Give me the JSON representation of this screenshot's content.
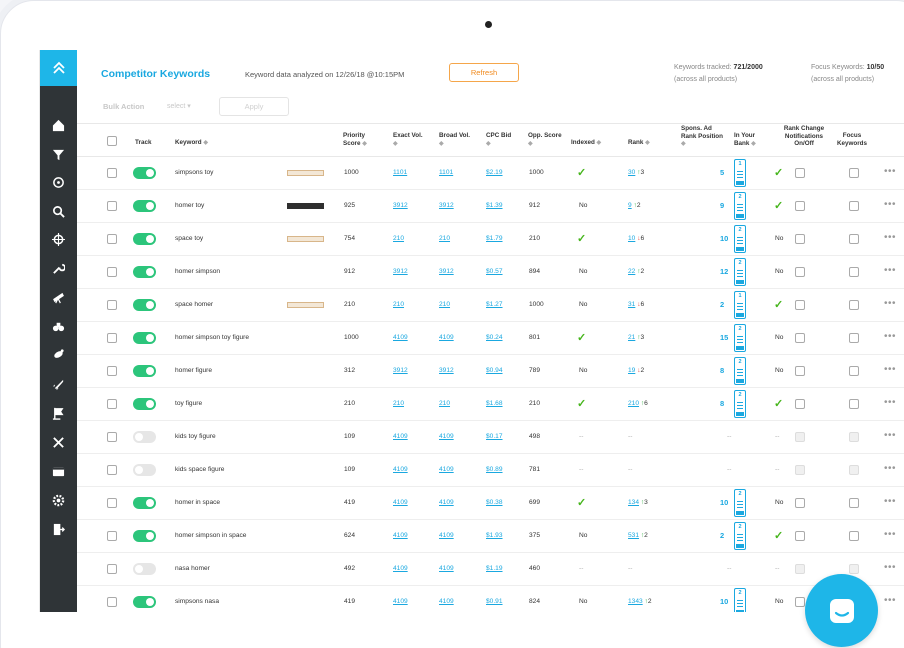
{
  "header": {
    "title": "Competitor Keywords",
    "analyzed": "Keyword data analyzed on 12/26/18 @10:15PM",
    "refresh_label": "Refresh",
    "tracked_label": "Keywords tracked:",
    "tracked_value": "721/2000",
    "tracked_note": "(across all products)",
    "focus_label": "Focus Keywords:",
    "focus_value": "10/50",
    "focus_note": "(across all products)"
  },
  "bulk": {
    "label": "Bulk Action",
    "select": "select",
    "apply": "Apply"
  },
  "columns": {
    "track": "Track",
    "keyword": "Keyword",
    "priority": "Priority Score",
    "exact": "Exact Vol.",
    "broad": "Broad Vol.",
    "cpc": "CPC Bid",
    "opp": "Opp. Score",
    "indexed": "Indexed",
    "rank": "Rank",
    "spons": "Spons. Ad Rank Position",
    "in_your_bank": "In Your Bank",
    "rank_change": "Rank Change Notifications On/Off",
    "focus": "Focus Keywords"
  },
  "rows": [
    {
      "on": true,
      "keyword": "simpsons toy",
      "badge": "light",
      "priority": "1000",
      "exact": "1101",
      "broad": "1101",
      "cpc": "$2.19",
      "opp": "1000",
      "indexed": "check",
      "rank": "30",
      "dir": "up",
      "change": "3",
      "spons": "5",
      "spons_rank": "1",
      "bank": "check"
    },
    {
      "on": true,
      "keyword": "homer toy",
      "badge": "dark",
      "priority": "925",
      "exact": "3912",
      "broad": "3912",
      "cpc": "$1.39",
      "opp": "912",
      "indexed": "No",
      "rank": "9",
      "dir": "up",
      "change": "2",
      "spons": "9",
      "spons_rank": "2",
      "bank": "check"
    },
    {
      "on": true,
      "keyword": "space toy",
      "badge": "light",
      "priority": "754",
      "exact": "210",
      "broad": "210",
      "cpc": "$1.79",
      "opp": "210",
      "indexed": "check",
      "rank": "10",
      "dir": "down",
      "change": "6",
      "spons": "10",
      "spons_rank": "2",
      "bank": "No"
    },
    {
      "on": true,
      "keyword": "homer simpson",
      "badge": "",
      "priority": "912",
      "exact": "3912",
      "broad": "3912",
      "cpc": "$0.57",
      "opp": "894",
      "indexed": "No",
      "rank": "22",
      "dir": "up",
      "change": "2",
      "spons": "12",
      "spons_rank": "2",
      "bank": "No"
    },
    {
      "on": true,
      "keyword": "space homer",
      "badge": "light",
      "priority": "210",
      "exact": "210",
      "broad": "210",
      "cpc": "$1.27",
      "opp": "1000",
      "indexed": "No",
      "rank": "31",
      "dir": "down",
      "change": "6",
      "spons": "2",
      "spons_rank": "1",
      "bank": "check"
    },
    {
      "on": true,
      "keyword": "homer simpson toy figure",
      "badge": "",
      "priority": "1000",
      "exact": "4109",
      "broad": "4109",
      "cpc": "$0.24",
      "opp": "801",
      "indexed": "check",
      "rank": "21",
      "dir": "up",
      "change": "3",
      "spons": "15",
      "spons_rank": "2",
      "bank": "No"
    },
    {
      "on": true,
      "keyword": "homer figure",
      "badge": "",
      "priority": "312",
      "exact": "3912",
      "broad": "3912",
      "cpc": "$0.94",
      "opp": "789",
      "indexed": "No",
      "rank": "19",
      "dir": "down",
      "change": "2",
      "spons": "8",
      "spons_rank": "2",
      "bank": "No"
    },
    {
      "on": true,
      "keyword": "toy figure",
      "badge": "",
      "priority": "210",
      "exact": "210",
      "broad": "210",
      "cpc": "$1.68",
      "opp": "210",
      "indexed": "check",
      "rank": "210",
      "dir": "up",
      "change": "6",
      "spons": "8",
      "spons_rank": "2",
      "bank": "check"
    },
    {
      "on": false,
      "keyword": "kids toy figure",
      "badge": "",
      "priority": "109",
      "exact": "4109",
      "broad": "4109",
      "cpc": "$0.17",
      "opp": "498",
      "indexed": "--",
      "rank": "--",
      "dir": "",
      "change": "",
      "spons": "--",
      "spons_rank": "",
      "bank": "--"
    },
    {
      "on": false,
      "keyword": "kids space figure",
      "badge": "",
      "priority": "109",
      "exact": "4109",
      "broad": "4109",
      "cpc": "$0.89",
      "opp": "781",
      "indexed": "--",
      "rank": "--",
      "dir": "",
      "change": "",
      "spons": "--",
      "spons_rank": "",
      "bank": "--"
    },
    {
      "on": true,
      "keyword": "homer in space",
      "badge": "",
      "priority": "419",
      "exact": "4109",
      "broad": "4109",
      "cpc": "$0.38",
      "opp": "699",
      "indexed": "check",
      "rank": "134",
      "dir": "up",
      "change": "3",
      "spons": "10",
      "spons_rank": "2",
      "bank": "No"
    },
    {
      "on": true,
      "keyword": "homer simpson in space",
      "badge": "",
      "priority": "624",
      "exact": "4109",
      "broad": "4109",
      "cpc": "$1.93",
      "opp": "375",
      "indexed": "No",
      "rank": "531",
      "dir": "up",
      "change": "2",
      "spons": "2",
      "spons_rank": "2",
      "bank": "check"
    },
    {
      "on": false,
      "keyword": "nasa homer",
      "badge": "",
      "priority": "492",
      "exact": "4109",
      "broad": "4109",
      "cpc": "$1.19",
      "opp": "460",
      "indexed": "--",
      "rank": "--",
      "dir": "",
      "change": "",
      "spons": "--",
      "spons_rank": "",
      "bank": "--"
    },
    {
      "on": true,
      "keyword": "simpsons nasa",
      "badge": "",
      "priority": "419",
      "exact": "4109",
      "broad": "4109",
      "cpc": "$0.91",
      "opp": "824",
      "indexed": "No",
      "rank": "1343",
      "dir": "up",
      "change": "2",
      "spons": "10",
      "spons_rank": "2",
      "bank": "No"
    }
  ],
  "colors": {
    "accent": "#1eb6e8",
    "sidebar": "#2f3437",
    "toggle_on": "#2cc57b",
    "refresh": "#f5a64a",
    "up": "#3bb54a",
    "down": "#e8463c"
  },
  "sidebar_icons": [
    "home-icon",
    "filter-icon",
    "target-icon",
    "search-icon",
    "crosshair-icon",
    "wrench-icon",
    "telescope-icon",
    "binoculars-icon",
    "satellite-icon",
    "rocket-icon",
    "flag-icon",
    "tools-icon",
    "wallet-icon",
    "gear-icon",
    "logout-icon"
  ]
}
